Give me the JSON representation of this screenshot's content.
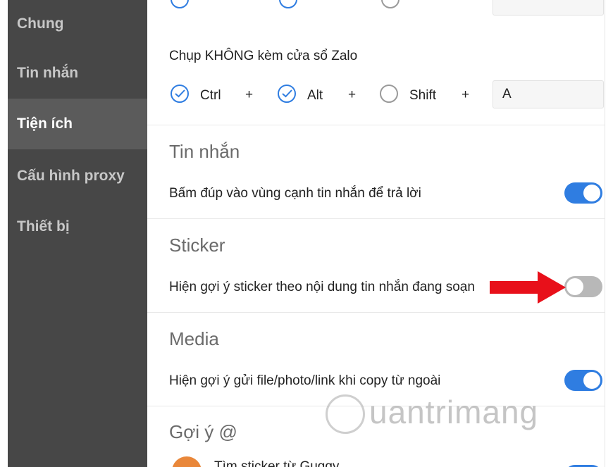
{
  "sidebar": {
    "items": [
      {
        "label": "Chung",
        "active": false
      },
      {
        "label": "Tin nhắn",
        "active": false
      },
      {
        "label": "Tiện ích",
        "active": true
      },
      {
        "label": "Cấu hình proxy",
        "active": false
      },
      {
        "label": "Thiết bị",
        "active": false
      }
    ]
  },
  "screenshot": {
    "label": "Chụp KHÔNG kèm cửa sổ Zalo",
    "keys": [
      {
        "label": "Ctrl",
        "checked": true
      },
      {
        "label": "Alt",
        "checked": true
      },
      {
        "label": "Shift",
        "checked": false
      }
    ],
    "plus": "+",
    "key_value": "A"
  },
  "messages": {
    "title": "Tin nhắn",
    "option": "Bấm đúp vào vùng cạnh tin nhắn để trả lời",
    "enabled": true
  },
  "sticker": {
    "title": "Sticker",
    "option": "Hiện gợi ý sticker theo nội dung tin nhắn đang soạn",
    "enabled": false
  },
  "media": {
    "title": "Media",
    "option": "Hiện gợi ý gửi file/photo/link khi copy từ ngoài",
    "enabled": true
  },
  "suggest": {
    "title": "Gợi ý @",
    "option": "Tìm sticker từ Guggy"
  },
  "watermark": "uantrimang",
  "colors": {
    "sidebar_bg": "#474747",
    "sidebar_active": "#5b5b5b",
    "accent": "#2f7de1",
    "toggle_off": "#b8b8b8",
    "arrow": "#e8101a"
  }
}
